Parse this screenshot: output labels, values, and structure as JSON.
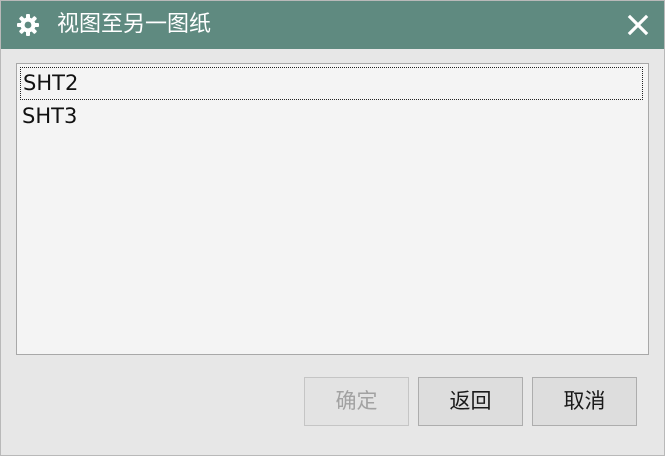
{
  "dialog": {
    "title": "视图至另一图纸",
    "title_icon": "gear-icon",
    "close_icon": "close-icon",
    "title_bar_color": "#5f8a80"
  },
  "sheet_list": {
    "items": [
      "SHT2",
      "SHT3"
    ],
    "focused_index": 0
  },
  "buttons": {
    "ok_label": "确定",
    "ok_enabled": false,
    "back_label": "返回",
    "cancel_label": "取消"
  }
}
